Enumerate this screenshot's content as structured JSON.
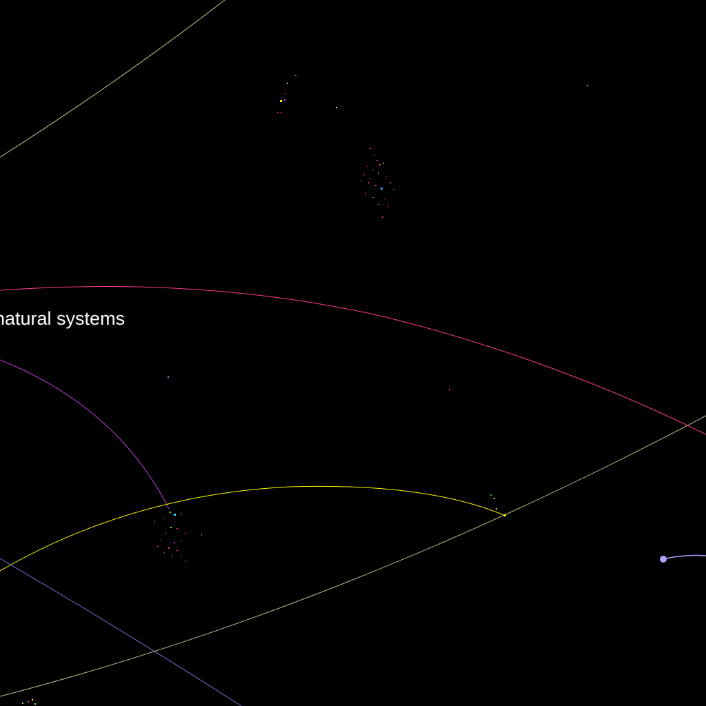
{
  "caption": "natural systems",
  "colors": {
    "background": "#000000",
    "caption": "#ffffff",
    "orbit_outer": "#c8c890",
    "orbit_pink": "#ff3c8c",
    "orbit_violet": "#c040e0",
    "orbit_yellow": "#ffff00",
    "orbit_blue": "#7070d0",
    "orbit_lower_pale": "#c0c090",
    "lavender_body": "#b0a0ff"
  }
}
